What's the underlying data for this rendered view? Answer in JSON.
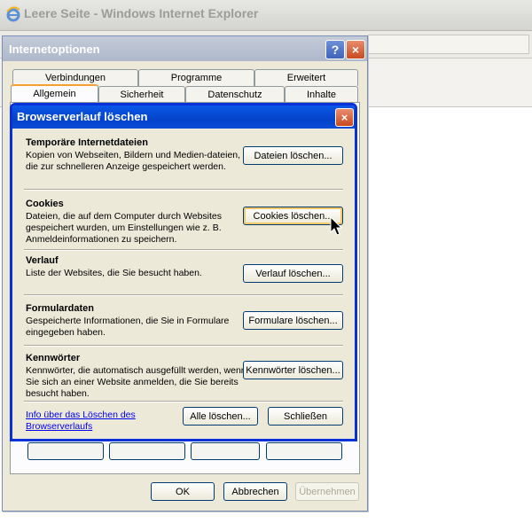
{
  "ie": {
    "title": "Leere Seite - Windows Internet Explorer",
    "logo_icon": "internet-explorer-icon"
  },
  "internet_options": {
    "title": "Internetoptionen",
    "help_label": "?",
    "close_label": "×",
    "tabs_top": [
      "Verbindungen",
      "Programme",
      "Erweitert"
    ],
    "tabs_bottom": [
      "Allgemein",
      "Sicherheit",
      "Datenschutz",
      "Inhalte"
    ],
    "active_tab": "Allgemein",
    "buttons": {
      "ok": "OK",
      "cancel": "Abbrechen",
      "apply": "Übernehmen"
    }
  },
  "delete_history": {
    "title": "Browserverlauf löschen",
    "close_label": "×",
    "groups": [
      {
        "heading": "Temporäre Internetdateien",
        "description": "Kopien von Webseiten, Bildern und Medien-dateien, die zur schnelleren Anzeige gespeichert werden.",
        "button": "Dateien löschen..."
      },
      {
        "heading": "Cookies",
        "description": "Dateien, die auf dem Computer durch Websites gespeichert wurden, um Einstellungen wie z. B. Anmeldeinformationen zu speichern.",
        "button": "Cookies löschen..."
      },
      {
        "heading": "Verlauf",
        "description": "Liste der Websites, die Sie besucht haben.",
        "button": "Verlauf löschen..."
      },
      {
        "heading": "Formulardaten",
        "description": "Gespeicherte Informationen, die Sie in Formulare eingegeben haben.",
        "button": "Formulare löschen..."
      },
      {
        "heading": "Kennwörter",
        "description": "Kennwörter, die automatisch ausgefüllt werden, wenn Sie sich an einer Website anmelden, die Sie bereits besucht haben.",
        "button": "Kennwörter löschen..."
      }
    ],
    "info_link": "Info über das Löschen des Browserverlaufs",
    "delete_all_button": "Alle löschen...",
    "close_button": "Schließen"
  }
}
